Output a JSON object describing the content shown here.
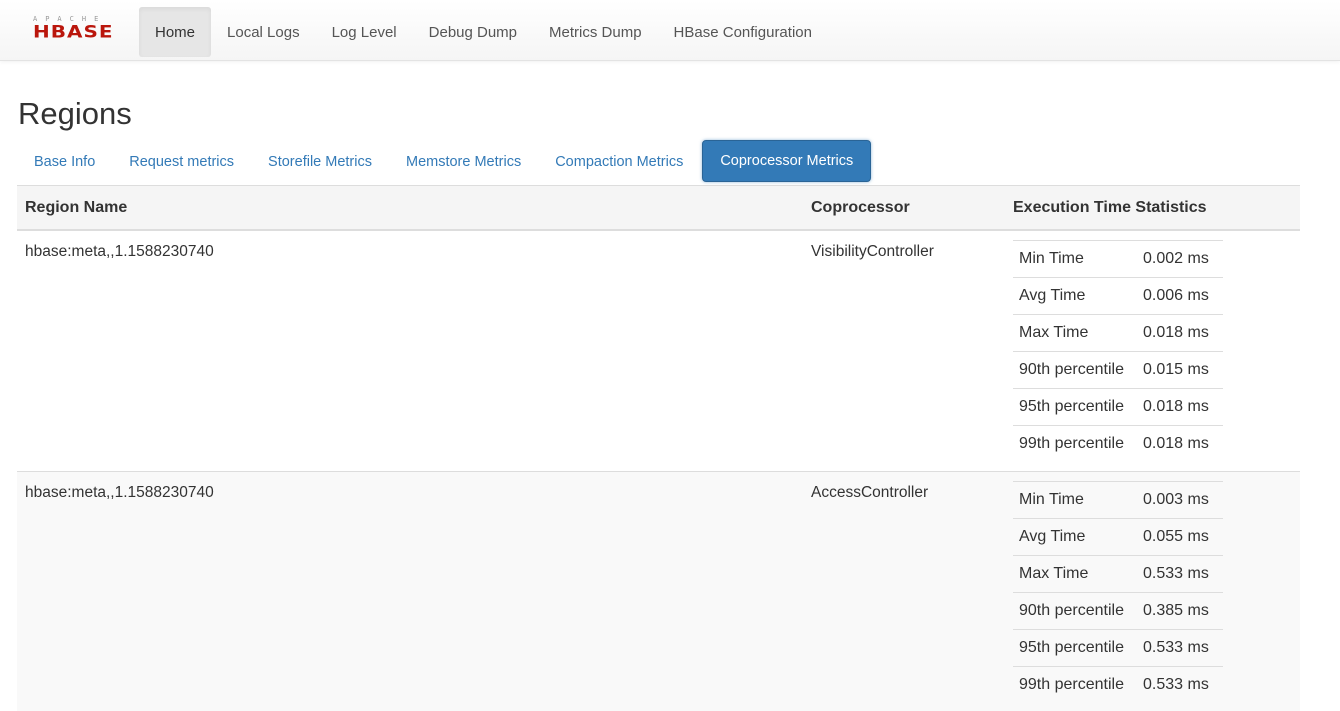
{
  "brand": {
    "apache": "APACHE",
    "hbase": "HBASE"
  },
  "nav": [
    "Home",
    "Local Logs",
    "Log Level",
    "Debug Dump",
    "Metrics Dump",
    "HBase Configuration"
  ],
  "page_title": "Regions",
  "tabs": [
    "Base Info",
    "Request metrics",
    "Storefile Metrics",
    "Memstore Metrics",
    "Compaction Metrics",
    "Coprocessor Metrics"
  ],
  "active_tab": "Coprocessor Metrics",
  "table": {
    "headers": [
      "Region Name",
      "Coprocessor",
      "Execution Time Statistics"
    ],
    "rows": [
      {
        "region": "hbase:meta,,1.1588230740",
        "coprocessor": "VisibilityController",
        "stats": [
          {
            "label": "Min Time",
            "value": "0.002 ms"
          },
          {
            "label": "Avg Time",
            "value": "0.006 ms"
          },
          {
            "label": "Max Time",
            "value": "0.018 ms"
          },
          {
            "label": "90th percentile",
            "value": "0.015 ms"
          },
          {
            "label": "95th percentile",
            "value": "0.018 ms"
          },
          {
            "label": "99th percentile",
            "value": "0.018 ms"
          }
        ]
      },
      {
        "region": "hbase:meta,,1.1588230740",
        "coprocessor": "AccessController",
        "stats": [
          {
            "label": "Min Time",
            "value": "0.003 ms"
          },
          {
            "label": "Avg Time",
            "value": "0.055 ms"
          },
          {
            "label": "Max Time",
            "value": "0.533 ms"
          },
          {
            "label": "90th percentile",
            "value": "0.385 ms"
          },
          {
            "label": "95th percentile",
            "value": "0.533 ms"
          },
          {
            "label": "99th percentile",
            "value": "0.533 ms"
          }
        ]
      }
    ]
  },
  "colors": {
    "link": "#337ab7",
    "brand_red": "#ba160c",
    "active_tab_bg": "#337ab7"
  }
}
